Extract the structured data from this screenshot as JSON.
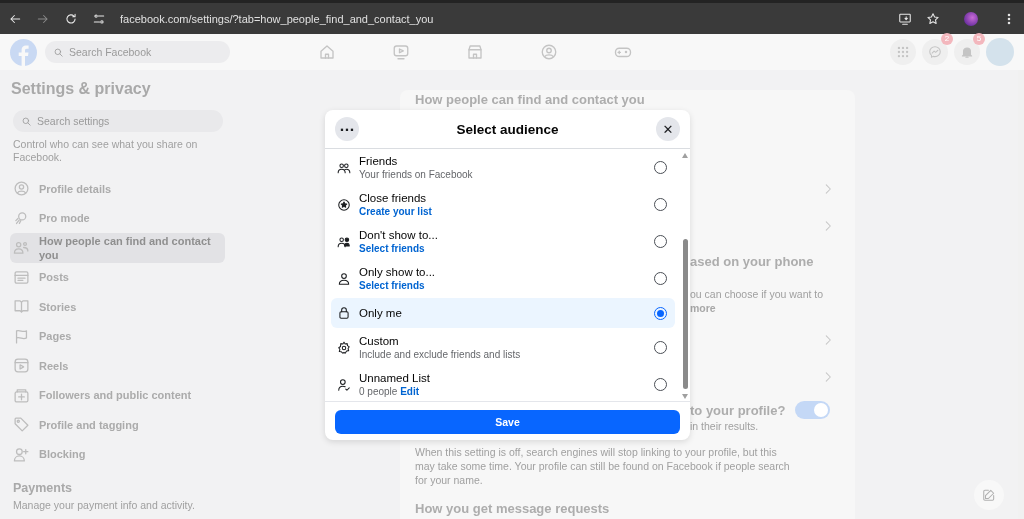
{
  "browser": {
    "url": "facebook.com/settings/?tab=how_people_find_and_contact_you"
  },
  "header": {
    "search_placeholder": "Search Facebook",
    "messenger_badge": "2",
    "notifications_badge": "5"
  },
  "sidebar": {
    "title": "Settings & privacy",
    "search_placeholder": "Search settings",
    "intro": "Control who can see what you share on Facebook.",
    "items": [
      {
        "label": "Profile details",
        "selected": false
      },
      {
        "label": "Pro mode",
        "selected": false
      },
      {
        "label": "How people can find and contact you",
        "selected": true
      },
      {
        "label": "Posts",
        "selected": false
      },
      {
        "label": "Stories",
        "selected": false
      },
      {
        "label": "Pages",
        "selected": false
      },
      {
        "label": "Reels",
        "selected": false
      },
      {
        "label": "Followers and public content",
        "selected": false
      },
      {
        "label": "Profile and tagging",
        "selected": false
      },
      {
        "label": "Blocking",
        "selected": false
      }
    ],
    "section_title": "Payments",
    "section_text": "Manage your payment info and activity."
  },
  "main": {
    "title": "How people can find and contact you",
    "phone_heading": "ased on your phone",
    "phone_text": "ou can choose if you want to",
    "learn_more": "more",
    "search_heading": "to your profile?",
    "search_text": "in their results.",
    "search_toggle": {
      "on": true
    },
    "search_note": "When this setting is off, search engines will stop linking to your profile, but this may take some time. Your profile can still be found on Facebook if people search for your name.",
    "message_heading": "How you get message requests"
  },
  "dialog": {
    "title": "Select audience",
    "more": "···",
    "close": "✕",
    "options": [
      {
        "title": "Friends",
        "subtitle": "Your friends on Facebook",
        "selected": false
      },
      {
        "title": "Close friends",
        "link": "Create your list",
        "selected": false
      },
      {
        "title": "Don't show to...",
        "link": "Select friends",
        "selected": false
      },
      {
        "title": "Only show to...",
        "link": "Select friends",
        "selected": false
      },
      {
        "title": "Only me",
        "selected": true
      },
      {
        "title": "Custom",
        "subtitle": "Include and exclude friends and lists",
        "selected": false
      },
      {
        "title": "Unnamed List",
        "subtitle": "0 people",
        "link": "Edit",
        "selected": false
      }
    ],
    "save": "Save"
  }
}
